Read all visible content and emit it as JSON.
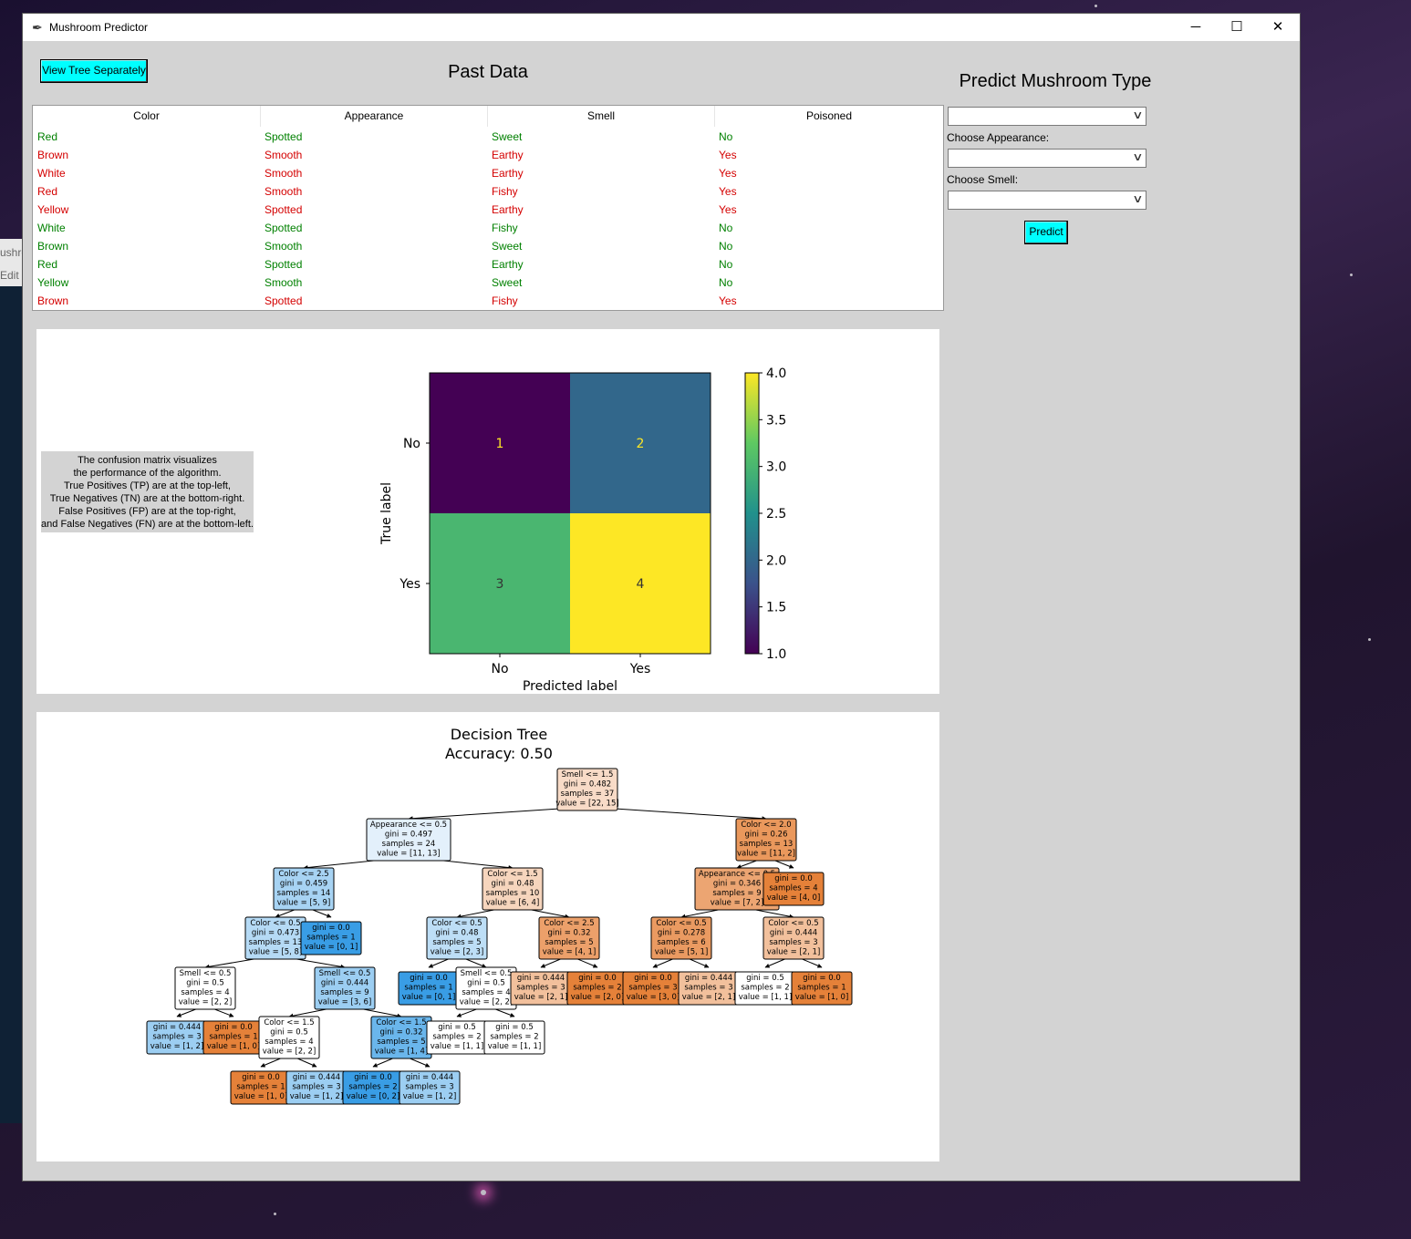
{
  "window": {
    "title": "Mushroom Predictor"
  },
  "background_window": {
    "tab": "ushro",
    "menu": "Edit"
  },
  "toolbar": {
    "view_tree_label": "View Tree Separately"
  },
  "past_data": {
    "title": "Past Data",
    "columns": [
      "Color",
      "Appearance",
      "Smell",
      "Poisoned"
    ],
    "rows": [
      {
        "cells": [
          "Red",
          "Spotted",
          "Sweet",
          "No"
        ],
        "color": "#008000"
      },
      {
        "cells": [
          "Brown",
          "Smooth",
          "Earthy",
          "Yes"
        ],
        "color": "#d40000"
      },
      {
        "cells": [
          "White",
          "Smooth",
          "Earthy",
          "Yes"
        ],
        "color": "#d40000"
      },
      {
        "cells": [
          "Red",
          "Smooth",
          "Fishy",
          "Yes"
        ],
        "color": "#d40000"
      },
      {
        "cells": [
          "Yellow",
          "Spotted",
          "Earthy",
          "Yes"
        ],
        "color": "#d40000"
      },
      {
        "cells": [
          "White",
          "Spotted",
          "Fishy",
          "No"
        ],
        "color": "#008000"
      },
      {
        "cells": [
          "Brown",
          "Smooth",
          "Sweet",
          "No"
        ],
        "color": "#008000"
      },
      {
        "cells": [
          "Red",
          "Spotted",
          "Earthy",
          "No"
        ],
        "color": "#008000"
      },
      {
        "cells": [
          "Yellow",
          "Smooth",
          "Sweet",
          "No"
        ],
        "color": "#008000"
      },
      {
        "cells": [
          "Brown",
          "Spotted",
          "Fishy",
          "Yes"
        ],
        "color": "#d40000"
      }
    ]
  },
  "predict": {
    "title": "Predict Mushroom Type",
    "color_value": "",
    "appearance_label": "Choose Appearance:",
    "appearance_value": "",
    "smell_label": "Choose Smell:",
    "smell_value": "",
    "button_label": "Predict"
  },
  "confusion_note": {
    "lines": [
      "The confusion matrix visualizes",
      "the performance of the algorithm.",
      "True Positives (TP) are at the top-left,",
      "True Negatives (TN) are at the bottom-right.",
      "False Positives (FP) are at the top-right,",
      "and False Negatives (FN) are at the bottom-left."
    ]
  },
  "chart_data": {
    "type": "heatmap",
    "title": "",
    "xlabel": "Predicted label",
    "ylabel": "True label",
    "x_categories": [
      "No",
      "Yes"
    ],
    "y_categories": [
      "No",
      "Yes"
    ],
    "values": [
      [
        1,
        2
      ],
      [
        3,
        4
      ]
    ],
    "colormap": "viridis",
    "colorbar": {
      "min": 1.0,
      "max": 4.0,
      "ticks": [
        "1.0",
        "1.5",
        "2.0",
        "2.5",
        "3.0",
        "3.5",
        "4.0"
      ]
    }
  },
  "decision_tree": {
    "title_line1": "Decision Tree",
    "title_line2": "Accuracy: 0.50",
    "nodes": [
      {
        "id": "n0",
        "lines": [
          "Smell <= 1.5",
          "gini = 0.482",
          "samples = 37",
          "value = [22, 15]"
        ],
        "color": "#f8dbc7"
      },
      {
        "id": "n1",
        "lines": [
          "Appearance <= 0.5",
          "gini = 0.497",
          "samples = 24",
          "value = [11, 13]"
        ],
        "color": "#e3f0fb"
      },
      {
        "id": "n2",
        "lines": [
          "Color <= 2.0",
          "gini = 0.26",
          "samples = 13",
          "value = [11, 2]"
        ],
        "color": "#ea985c"
      },
      {
        "id": "n3",
        "lines": [
          "Color <= 2.5",
          "gini = 0.459",
          "samples = 14",
          "value = [5, 9]"
        ],
        "color": "#a7d3f3"
      },
      {
        "id": "n4",
        "lines": [
          "Color <= 1.5",
          "gini = 0.48",
          "samples = 10",
          "value = [6, 4]"
        ],
        "color": "#f6d5bd"
      },
      {
        "id": "n5",
        "lines": [
          "Appearance <= 0.5",
          "gini = 0.346",
          "samples = 9",
          "value = [7, 2]"
        ],
        "color": "#eca572"
      },
      {
        "id": "n6",
        "lines": [
          "gini = 0.0",
          "samples = 4",
          "value = [4, 0]"
        ],
        "color": "#e58139"
      },
      {
        "id": "n7",
        "lines": [
          "Color <= 0.5",
          "gini = 0.473",
          "samples = 13",
          "value = [5, 8]"
        ],
        "color": "#b5daf5"
      },
      {
        "id": "n8",
        "lines": [
          "gini = 0.0",
          "samples = 1",
          "value = [0, 1]"
        ],
        "color": "#399de5"
      },
      {
        "id": "n9",
        "lines": [
          "Color <= 0.5",
          "gini = 0.48",
          "samples = 5",
          "value = [2, 3]"
        ],
        "color": "#bddef6"
      },
      {
        "id": "n10",
        "lines": [
          "Color <= 2.5",
          "gini = 0.32",
          "samples = 5",
          "value = [4, 1]"
        ],
        "color": "#eca06a"
      },
      {
        "id": "n11",
        "lines": [
          "Color <= 0.5",
          "gini = 0.278",
          "samples = 6",
          "value = [5, 1]"
        ],
        "color": "#ea9a61"
      },
      {
        "id": "n12",
        "lines": [
          "Color <= 0.5",
          "gini = 0.444",
          "samples = 3",
          "value = [2, 1]"
        ],
        "color": "#f2c09c"
      },
      {
        "id": "n13",
        "lines": [
          "Smell <= 0.5",
          "gini = 0.5",
          "samples = 4",
          "value = [2, 2]"
        ],
        "color": "#ffffff"
      },
      {
        "id": "n14",
        "lines": [
          "Smell <= 0.5",
          "gini = 0.444",
          "samples = 9",
          "value = [3, 6]"
        ],
        "color": "#9ccef2"
      },
      {
        "id": "n15",
        "lines": [
          "gini = 0.0",
          "samples = 1",
          "value = [0, 1]"
        ],
        "color": "#399de5"
      },
      {
        "id": "n16",
        "lines": [
          "Smell <= 0.5",
          "gini = 0.5",
          "samples = 4",
          "value = [2, 2]"
        ],
        "color": "#ffffff"
      },
      {
        "id": "n17",
        "lines": [
          "gini = 0.444",
          "samples = 3",
          "value = [2, 1]"
        ],
        "color": "#f2c09c"
      },
      {
        "id": "n18",
        "lines": [
          "gini = 0.0",
          "samples = 2",
          "value = [2, 0]"
        ],
        "color": "#e58139"
      },
      {
        "id": "n19",
        "lines": [
          "gini = 0.0",
          "samples = 3",
          "value = [3, 0]"
        ],
        "color": "#e58139"
      },
      {
        "id": "n20",
        "lines": [
          "gini = 0.444",
          "samples = 3",
          "value = [2, 1]"
        ],
        "color": "#f2c09c"
      },
      {
        "id": "n21",
        "lines": [
          "gini = 0.5",
          "samples = 2",
          "value = [1, 1]"
        ],
        "color": "#ffffff"
      },
      {
        "id": "n22",
        "lines": [
          "gini = 0.0",
          "samples = 1",
          "value = [1, 0]"
        ],
        "color": "#e58139"
      },
      {
        "id": "n23",
        "lines": [
          "gini = 0.444",
          "samples = 3",
          "value = [1, 2]"
        ],
        "color": "#9ccef2"
      },
      {
        "id": "n24",
        "lines": [
          "gini = 0.0",
          "samples = 1",
          "value = [1, 0]"
        ],
        "color": "#e58139"
      },
      {
        "id": "n25",
        "lines": [
          "Color <= 1.5",
          "gini = 0.5",
          "samples = 4",
          "value = [2, 2]"
        ],
        "color": "#ffffff"
      },
      {
        "id": "n26",
        "lines": [
          "Color <= 1.5",
          "gini = 0.32",
          "samples = 5",
          "value = [1, 4]"
        ],
        "color": "#6ab6ec"
      },
      {
        "id": "n27",
        "lines": [
          "gini = 0.5",
          "samples = 2",
          "value = [1, 1]"
        ],
        "color": "#ffffff"
      },
      {
        "id": "n28",
        "lines": [
          "gini = 0.5",
          "samples = 2",
          "value = [1, 1]"
        ],
        "color": "#ffffff"
      },
      {
        "id": "n29",
        "lines": [
          "gini = 0.0",
          "samples = 1",
          "value = [1, 0]"
        ],
        "color": "#e58139"
      },
      {
        "id": "n30",
        "lines": [
          "gini = 0.444",
          "samples = 3",
          "value = [1, 2]"
        ],
        "color": "#9ccef2"
      },
      {
        "id": "n31",
        "lines": [
          "gini = 0.0",
          "samples = 2",
          "value = [0, 2]"
        ],
        "color": "#399de5"
      },
      {
        "id": "n32",
        "lines": [
          "gini = 0.444",
          "samples = 3",
          "value = [1, 2]"
        ],
        "color": "#9ccef2"
      }
    ],
    "edges": [
      [
        "n0",
        "n1"
      ],
      [
        "n0",
        "n2"
      ],
      [
        "n1",
        "n3"
      ],
      [
        "n1",
        "n4"
      ],
      [
        "n2",
        "n5"
      ],
      [
        "n2",
        "n6"
      ],
      [
        "n3",
        "n7"
      ],
      [
        "n3",
        "n8"
      ],
      [
        "n4",
        "n9"
      ],
      [
        "n4",
        "n10"
      ],
      [
        "n5",
        "n11"
      ],
      [
        "n5",
        "n12"
      ],
      [
        "n7",
        "n13"
      ],
      [
        "n7",
        "n14"
      ],
      [
        "n9",
        "n15"
      ],
      [
        "n9",
        "n16"
      ],
      [
        "n10",
        "n17"
      ],
      [
        "n10",
        "n18"
      ],
      [
        "n11",
        "n19"
      ],
      [
        "n11",
        "n20"
      ],
      [
        "n12",
        "n21"
      ],
      [
        "n12",
        "n22"
      ],
      [
        "n13",
        "n23"
      ],
      [
        "n13",
        "n24"
      ],
      [
        "n14",
        "n25"
      ],
      [
        "n14",
        "n26"
      ],
      [
        "n16",
        "n27"
      ],
      [
        "n16",
        "n28"
      ],
      [
        "n25",
        "n29"
      ],
      [
        "n25",
        "n30"
      ],
      [
        "n26",
        "n31"
      ],
      [
        "n26",
        "n32"
      ]
    ]
  }
}
